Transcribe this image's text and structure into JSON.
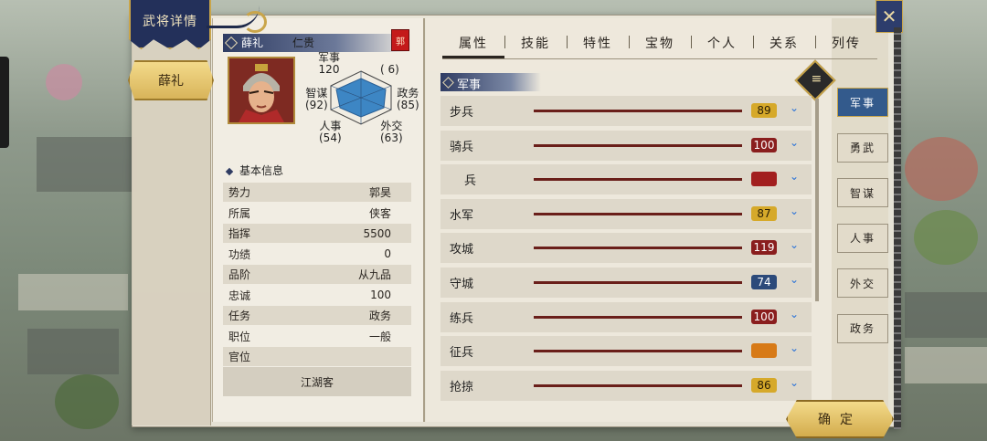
{
  "window": {
    "title": "武将详情"
  },
  "general": {
    "name": "薛礼",
    "trait": "仁贵",
    "faction_seal": "郭"
  },
  "stats": {
    "military": {
      "label": "军事",
      "value": "120"
    },
    "paren_top": "(    6)",
    "strategy": {
      "label": "智谋",
      "value": "(92)"
    },
    "politics": {
      "label": "政务",
      "value": "(85)"
    },
    "personnel": {
      "label": "人事",
      "value": "(54)"
    },
    "diplomacy": {
      "label": "外交",
      "value": "(63)"
    }
  },
  "basic_info": {
    "heading": "基本信息",
    "rows": [
      {
        "label": "势力",
        "value": "郭昊"
      },
      {
        "label": "所属",
        "value": "侠客"
      },
      {
        "label": "指挥",
        "value": "5500"
      },
      {
        "label": "功绩",
        "value": "0"
      },
      {
        "label": "品阶",
        "value": "从九品"
      },
      {
        "label": "忠诚",
        "value": "100"
      },
      {
        "label": "任务",
        "value": "政务"
      },
      {
        "label": "职位",
        "value": "一般"
      },
      {
        "label": "官位",
        "value": ""
      }
    ],
    "title_value": "江湖客"
  },
  "tabs": [
    "属性",
    "技能",
    "特性",
    "宝物",
    "个人",
    "关系",
    "列传"
  ],
  "section": {
    "title": "军事"
  },
  "skills": [
    {
      "name": "步兵",
      "value": "89",
      "color": "#d6a92a"
    },
    {
      "name": "骑兵",
      "value": "100",
      "color": "#8a1e1e"
    },
    {
      "name": "兵",
      "value": "",
      "color": "#a21f1f"
    },
    {
      "name": "水军",
      "value": "87",
      "color": "#d6a92a"
    },
    {
      "name": "攻城",
      "value": "119",
      "color": "#8a1e1e"
    },
    {
      "name": "守城",
      "value": "74",
      "color": "#2c4a7a"
    },
    {
      "name": "练兵",
      "value": "100",
      "color": "#8a1e1e"
    },
    {
      "name": "征兵",
      "value": "",
      "color": "#d77a17"
    },
    {
      "name": "抢掠",
      "value": "86",
      "color": "#d6a92a"
    }
  ],
  "side_tabs": [
    "军事",
    "勇武",
    "智谋",
    "人事",
    "外交",
    "政务"
  ],
  "icons": {
    "close": "close-x-icon",
    "list": "list-icon",
    "chevron": "chevron-down-icon"
  },
  "buttons": {
    "confirm": "确定"
  }
}
